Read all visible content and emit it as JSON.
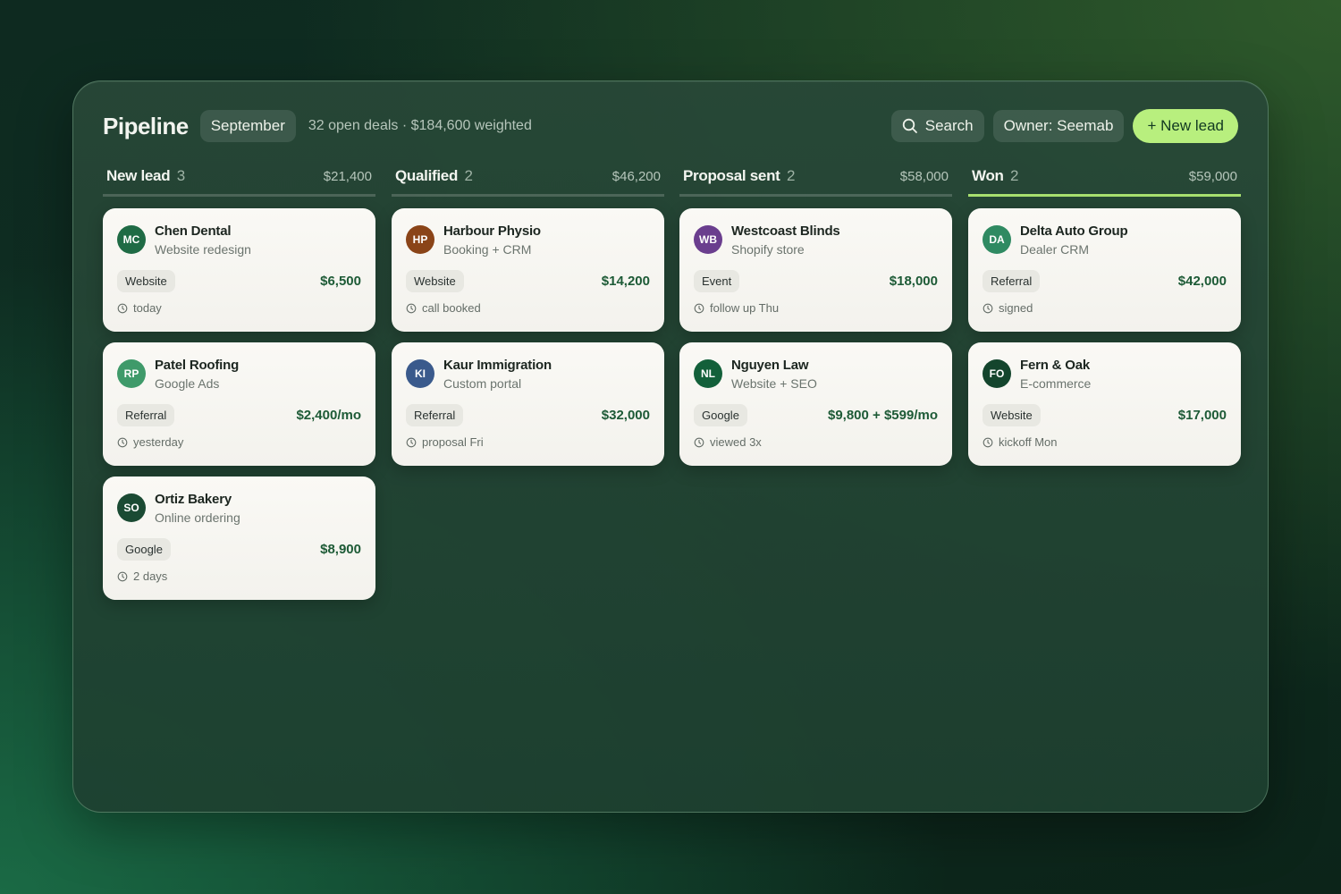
{
  "header": {
    "title": "Pipeline",
    "month": "September",
    "summary": "32 open deals · $184,600 weighted",
    "search_label": "Search",
    "owner_label": "Owner: Seemab",
    "new_lead_label": "+ New lead"
  },
  "columns": [
    {
      "name": "New lead",
      "count": "3",
      "total": "$21,400",
      "cards": [
        {
          "initials": "MC",
          "color": "#1f6b45",
          "company": "Chen Dental",
          "project": "Website redesign",
          "tag": "Website",
          "amount": "$6,500",
          "meta": "today"
        },
        {
          "initials": "RP",
          "color": "#3f9a6a",
          "company": "Patel Roofing",
          "project": "Google Ads",
          "tag": "Referral",
          "amount": "$2,400/mo",
          "meta": "yesterday"
        },
        {
          "initials": "SO",
          "color": "#1a4a33",
          "company": "Ortiz Bakery",
          "project": "Online ordering",
          "tag": "Google",
          "amount": "$8,900",
          "meta": "2 days"
        }
      ]
    },
    {
      "name": "Qualified",
      "count": "2",
      "total": "$46,200",
      "cards": [
        {
          "initials": "HP",
          "color": "#8a4418",
          "company": "Harbour Physio",
          "project": "Booking + CRM",
          "tag": "Website",
          "amount": "$14,200",
          "meta": "call booked"
        },
        {
          "initials": "KI",
          "color": "#3a5a8c",
          "company": "Kaur Immigration",
          "project": "Custom portal",
          "tag": "Referral",
          "amount": "$32,000",
          "meta": "proposal Fri"
        }
      ]
    },
    {
      "name": "Proposal sent",
      "count": "2",
      "total": "$58,000",
      "cards": [
        {
          "initials": "WB",
          "color": "#6a3e8e",
          "company": "Westcoast Blinds",
          "project": "Shopify store",
          "tag": "Event",
          "amount": "$18,000",
          "meta": "follow up Thu"
        },
        {
          "initials": "NL",
          "color": "#13603a",
          "company": "Nguyen Law",
          "project": "Website + SEO",
          "tag": "Google",
          "amount": "$9,800 + $599/mo",
          "meta": "viewed 3x"
        }
      ]
    },
    {
      "name": "Won",
      "count": "2",
      "total": "$59,000",
      "cards": [
        {
          "initials": "DA",
          "color": "#2f8a62",
          "company": "Delta Auto Group",
          "project": "Dealer CRM",
          "tag": "Referral",
          "amount": "$42,000",
          "meta": "signed"
        },
        {
          "initials": "FO",
          "color": "#14452d",
          "company": "Fern & Oak",
          "project": "E-commerce",
          "tag": "Website",
          "amount": "$17,000",
          "meta": "kickoff Mon"
        }
      ]
    }
  ],
  "colors": {
    "accent": "#b8ef7e",
    "won_underline": "#a8e06f",
    "amount_text": "#1d5a36"
  },
  "icons": {
    "search": "search-icon",
    "meta": "clock-icon"
  }
}
